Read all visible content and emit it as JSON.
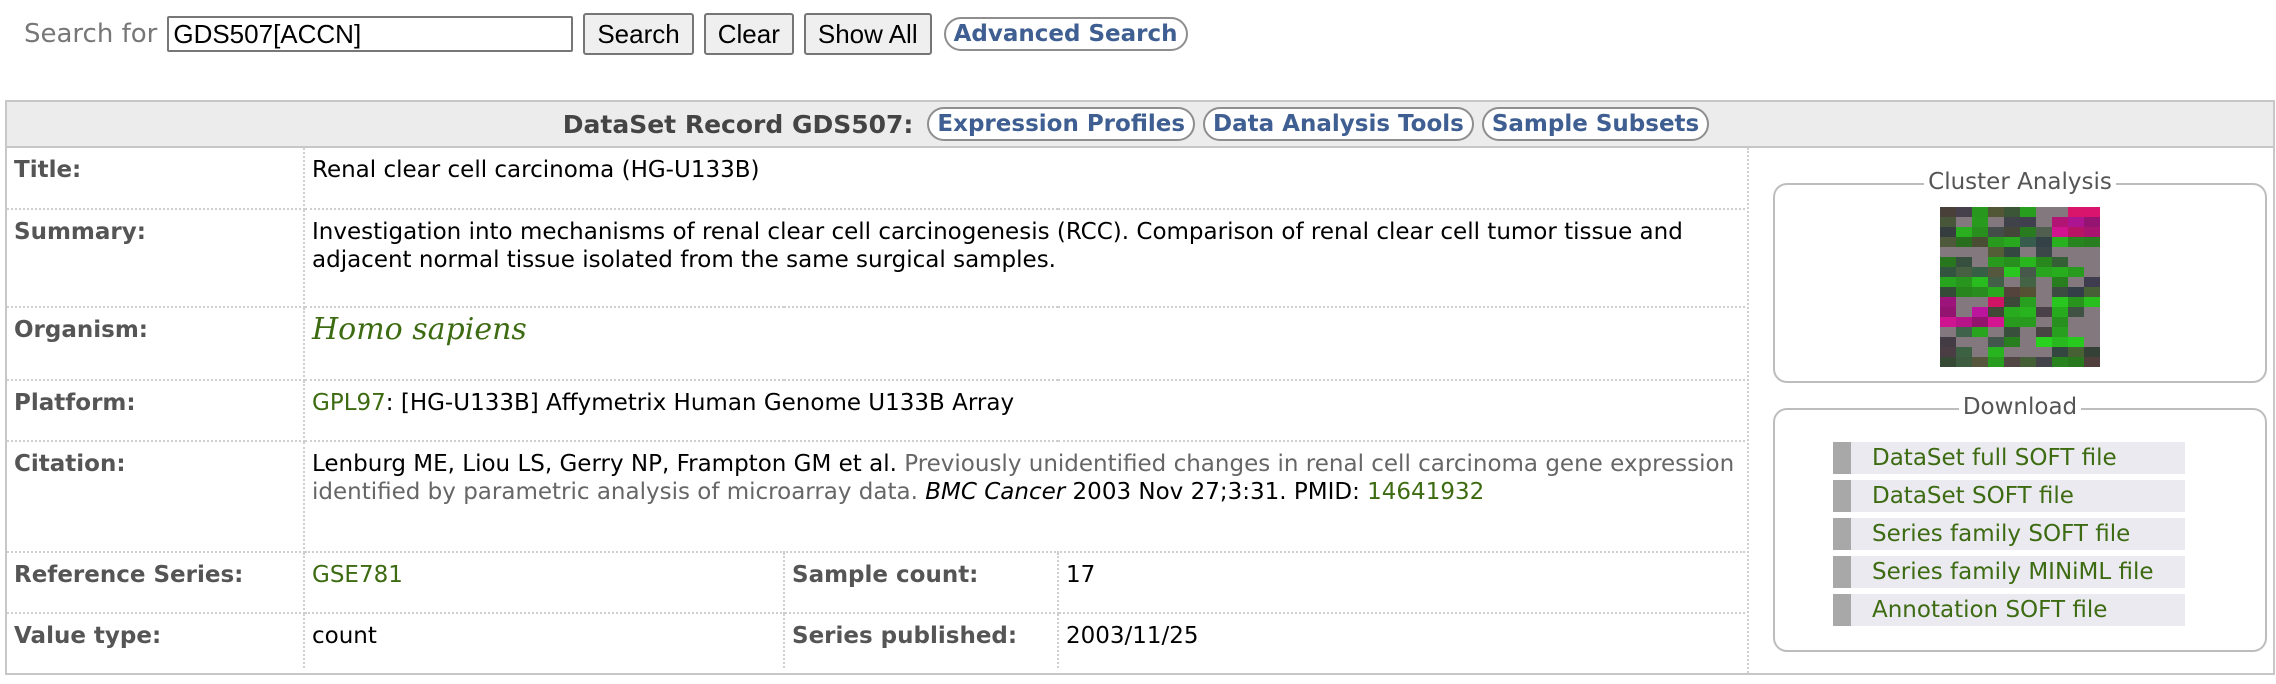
{
  "search": {
    "label": "Search for",
    "value": "GDS507[ACCN]",
    "buttons": {
      "search": "Search",
      "clear": "Clear",
      "show_all": "Show All"
    },
    "advanced": "Advanced Search"
  },
  "record": {
    "header_title": "DataSet Record GDS507:",
    "tabs": [
      "Expression Profiles",
      "Data Analysis Tools",
      "Sample Subsets"
    ],
    "title_label": "Title:",
    "title_value": "Renal clear cell carcinoma (HG-U133B)",
    "summary_label": "Summary:",
    "summary_value": "Investigation into mechanisms of renal clear cell carcinogenesis (RCC). Comparison of renal clear cell tumor tissue and adjacent normal tissue isolated from the same surgical samples.",
    "organism_label": "Organism:",
    "organism_value": "Homo sapiens",
    "platform_label": "Platform:",
    "platform_link": "GPL97",
    "platform_text": ": [HG-U133B] Affymetrix Human Genome U133B Array",
    "citation_label": "Citation:",
    "citation_authors": "Lenburg ME, Liou LS, Gerry NP, Frampton GM et al.",
    "citation_title": "Previously unidentified changes in renal cell carcinoma gene expression identified by parametric analysis of microarray data.",
    "citation_journal": "BMC Cancer",
    "citation_details": "2003 Nov 27;3:31. PMID:",
    "citation_pmid": "14641932",
    "ref_series_label": "Reference Series:",
    "ref_series_value": "GSE781",
    "sample_count_label": "Sample count:",
    "sample_count_value": "17",
    "value_type_label": "Value type:",
    "value_type_value": "count",
    "series_published_label": "Series published:",
    "series_published_value": "2003/11/25"
  },
  "cluster": {
    "legend": "Cluster Analysis"
  },
  "download": {
    "legend": "Download",
    "items": [
      "DataSet full SOFT file",
      "DataSet SOFT file",
      "Series family SOFT file",
      "Series family MINiML file",
      "Annotation SOFT file"
    ]
  },
  "colors": {
    "link_blue": "#3f5f92",
    "link_green": "#3d6b12",
    "heat_green": "#3fae2a",
    "heat_magenta": "#c0128a"
  }
}
